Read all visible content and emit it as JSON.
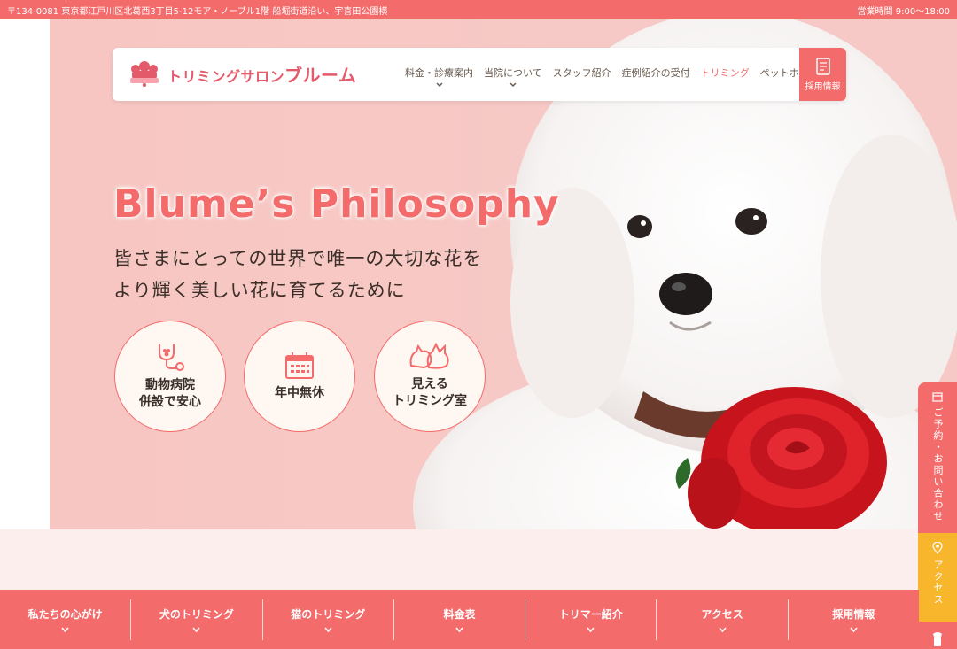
{
  "topbar": {
    "address": "〒134-0081 東京都江戸川区北葛西3丁目5-12モア・ノーブル1階 船堀街道沿い、宇喜田公園横",
    "hours": "営業時間 9:00〜18:00"
  },
  "logo": {
    "text_a": "トリミングサロン",
    "text_b": "ブルーム"
  },
  "nav": {
    "items": [
      {
        "label": "料金・診療案内"
      },
      {
        "label": "当院について"
      },
      {
        "label": "スタッフ紹介"
      },
      {
        "label": "症例紹介の受付"
      },
      {
        "label": "トリミング"
      },
      {
        "label": "ペットホテル"
      }
    ],
    "recruit_label": "採用情報"
  },
  "hero": {
    "title": "Blume’s Philosophy",
    "subtitle_line1": "皆さまにとっての世界で唯一の大切な花を",
    "subtitle_line2": "より輝く美しい花に育てるために",
    "features": [
      {
        "line1": "動物病院",
        "line2": "併設で安心",
        "icon": "stethoscope-paw-icon"
      },
      {
        "line1": "年中無休",
        "line2": "",
        "icon": "calendar-icon"
      },
      {
        "line1": "見える",
        "line2": "トリミング室",
        "icon": "dog-cat-icon"
      }
    ]
  },
  "side": {
    "reserve_label": "ご予約・お問い合わせ",
    "access_label": "アクセス"
  },
  "bottom_nav": [
    {
      "label": "私たちの心がけ"
    },
    {
      "label": "犬のトリミング"
    },
    {
      "label": "猫のトリミング"
    },
    {
      "label": "料金表"
    },
    {
      "label": "トリマー紹介"
    },
    {
      "label": "アクセス"
    },
    {
      "label": "採用情報"
    }
  ],
  "colors": {
    "accent": "#f36b6b",
    "hero_bg": "#f6c9c6",
    "access": "#f8b62d",
    "text": "#3a2e28"
  }
}
